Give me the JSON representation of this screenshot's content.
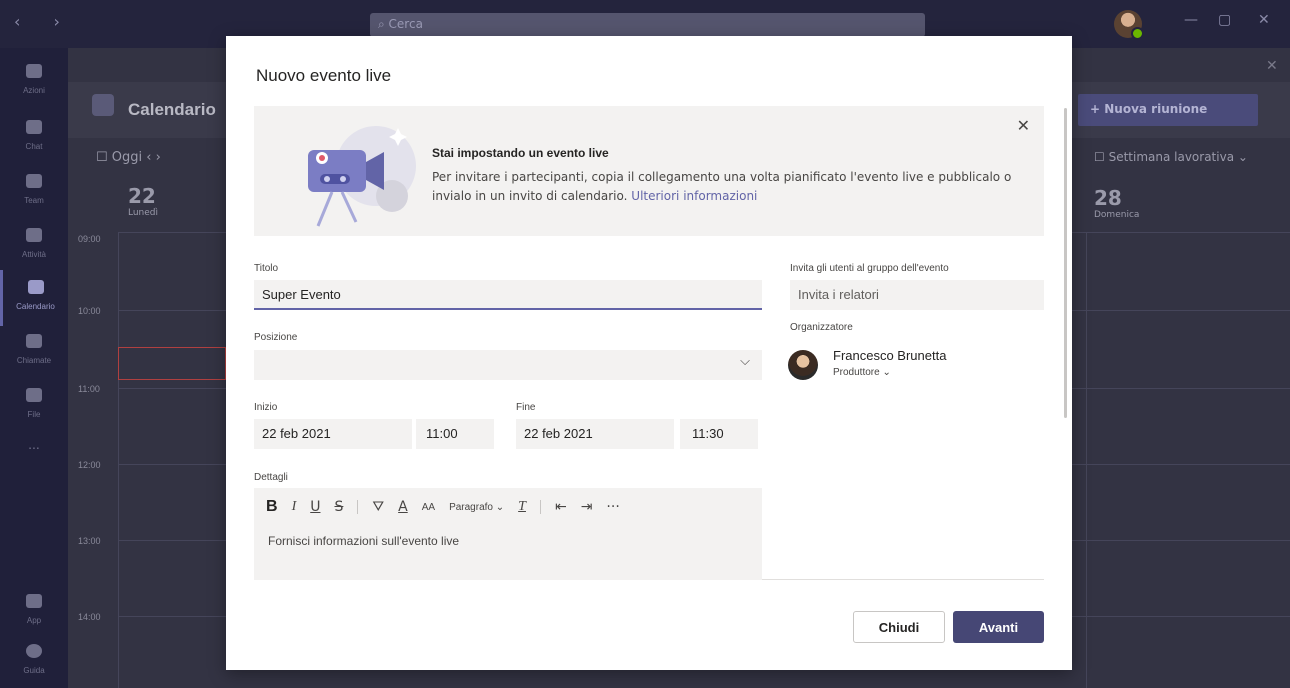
{
  "titlebar": {
    "search_placeholder": "Cerca"
  },
  "rail": {
    "items": [
      {
        "label": "Azioni",
        "icon": "bell-icon"
      },
      {
        "label": "Chat",
        "icon": "chat-icon"
      },
      {
        "label": "Team",
        "icon": "team-icon"
      },
      {
        "label": "Attività",
        "icon": "activity-icon"
      },
      {
        "label": "Calendario",
        "icon": "calendar-icon",
        "active": true
      },
      {
        "label": "Chiamate",
        "icon": "phone-icon"
      },
      {
        "label": "File",
        "icon": "file-icon"
      },
      {
        "label": "...",
        "icon": "more-icon"
      },
      {
        "label": "App",
        "icon": "apps-icon"
      },
      {
        "label": "Guida",
        "icon": "help-icon"
      }
    ]
  },
  "calendar": {
    "title": "Calendario",
    "today_label": "Oggi",
    "new_meeting_label": "+ Nuova riunione",
    "view_label": "Settimana lavorativa",
    "first_day": {
      "number": "22",
      "name": "Lunedì"
    },
    "last_day": {
      "number": "28",
      "name": "Domenica"
    },
    "hours": [
      "09:00",
      "10:00",
      "11:00",
      "12:00",
      "13:00",
      "14:00"
    ]
  },
  "modal": {
    "title": "Nuovo evento live",
    "banner": {
      "heading": "Stai impostando un evento live",
      "text": "Per invitare i partecipanti, copia il collegamento una volta pianificato l'evento live e pubblicalo o invialo in un invito di calendario.",
      "link": "Ulteriori informazioni"
    },
    "form": {
      "title_label": "Titolo",
      "title_value": "Super Evento",
      "location_label": "Posizione",
      "location_value": "",
      "start_label": "Inizio",
      "start_date": "22 feb 2021",
      "start_time": "11:00",
      "end_label": "Fine",
      "end_date": "22 feb 2021",
      "end_time": "11:30",
      "details_label": "Dettagli",
      "details_placeholder": "Fornisci informazioni sull'evento live",
      "paragraph_label": "Paragrafo"
    },
    "invite": {
      "label": "Invita gli utenti al gruppo dell'evento",
      "placeholder": "Invita i relatori"
    },
    "organizer": {
      "label": "Organizzatore",
      "name": "Francesco Brunetta",
      "role": "Produttore"
    },
    "buttons": {
      "close": "Chiudi",
      "next": "Avanti"
    }
  },
  "colors": {
    "accent": "#6264a7",
    "primary_button": "#464775",
    "field_bg": "#f3f2f1"
  }
}
